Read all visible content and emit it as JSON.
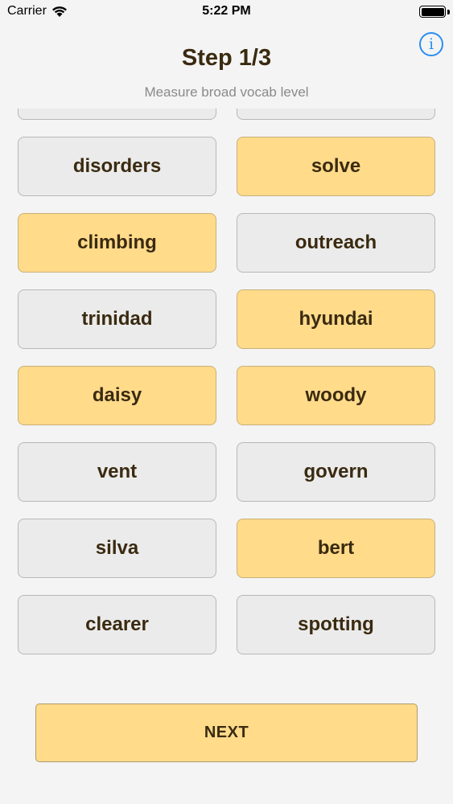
{
  "status_bar": {
    "carrier": "Carrier",
    "time": "5:22 PM"
  },
  "header": {
    "title": "Step 1/3",
    "subtitle": "Measure broad vocab level",
    "info_icon": "i"
  },
  "words": [
    {
      "left": {
        "word": "",
        "selected": false
      },
      "right": {
        "word": "",
        "selected": false
      }
    },
    {
      "left": {
        "word": "disorders",
        "selected": false
      },
      "right": {
        "word": "solve",
        "selected": true
      }
    },
    {
      "left": {
        "word": "climbing",
        "selected": true
      },
      "right": {
        "word": "outreach",
        "selected": false
      }
    },
    {
      "left": {
        "word": "trinidad",
        "selected": false
      },
      "right": {
        "word": "hyundai",
        "selected": true
      }
    },
    {
      "left": {
        "word": "daisy",
        "selected": true
      },
      "right": {
        "word": "woody",
        "selected": true
      }
    },
    {
      "left": {
        "word": "vent",
        "selected": false
      },
      "right": {
        "word": "govern",
        "selected": false
      }
    },
    {
      "left": {
        "word": "silva",
        "selected": false
      },
      "right": {
        "word": "bert",
        "selected": true
      }
    },
    {
      "left": {
        "word": "clearer",
        "selected": false
      },
      "right": {
        "word": "spotting",
        "selected": false
      }
    }
  ],
  "next_button": {
    "label": "NEXT"
  },
  "colors": {
    "selected": "#ffdb8a",
    "unselected": "#ebebeb",
    "accent": "#2a8ff0",
    "text": "#3a2a10"
  }
}
